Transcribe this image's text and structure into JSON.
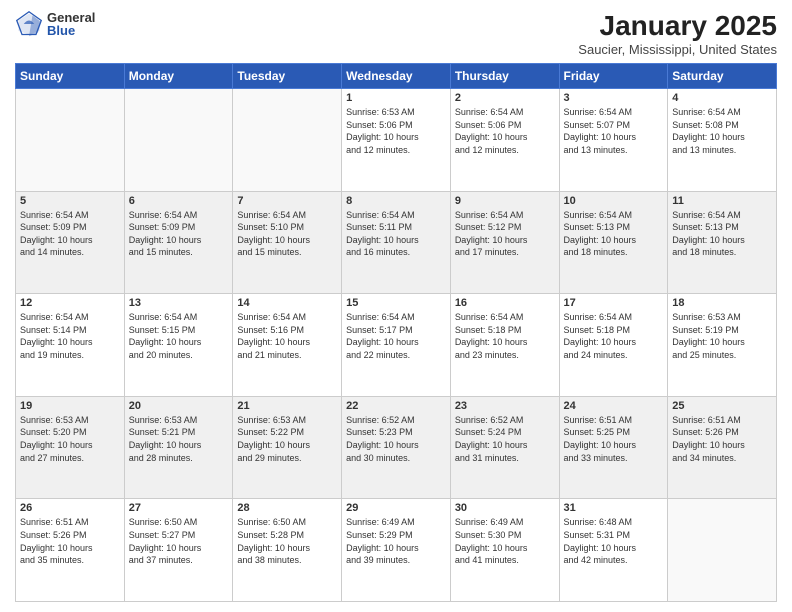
{
  "logo": {
    "general": "General",
    "blue": "Blue"
  },
  "header": {
    "month": "January 2025",
    "location": "Saucier, Mississippi, United States"
  },
  "weekdays": [
    "Sunday",
    "Monday",
    "Tuesday",
    "Wednesday",
    "Thursday",
    "Friday",
    "Saturday"
  ],
  "weeks": [
    [
      {
        "day": "",
        "info": ""
      },
      {
        "day": "",
        "info": ""
      },
      {
        "day": "",
        "info": ""
      },
      {
        "day": "1",
        "info": "Sunrise: 6:53 AM\nSunset: 5:06 PM\nDaylight: 10 hours\nand 12 minutes."
      },
      {
        "day": "2",
        "info": "Sunrise: 6:54 AM\nSunset: 5:06 PM\nDaylight: 10 hours\nand 12 minutes."
      },
      {
        "day": "3",
        "info": "Sunrise: 6:54 AM\nSunset: 5:07 PM\nDaylight: 10 hours\nand 13 minutes."
      },
      {
        "day": "4",
        "info": "Sunrise: 6:54 AM\nSunset: 5:08 PM\nDaylight: 10 hours\nand 13 minutes."
      }
    ],
    [
      {
        "day": "5",
        "info": "Sunrise: 6:54 AM\nSunset: 5:09 PM\nDaylight: 10 hours\nand 14 minutes."
      },
      {
        "day": "6",
        "info": "Sunrise: 6:54 AM\nSunset: 5:09 PM\nDaylight: 10 hours\nand 15 minutes."
      },
      {
        "day": "7",
        "info": "Sunrise: 6:54 AM\nSunset: 5:10 PM\nDaylight: 10 hours\nand 15 minutes."
      },
      {
        "day": "8",
        "info": "Sunrise: 6:54 AM\nSunset: 5:11 PM\nDaylight: 10 hours\nand 16 minutes."
      },
      {
        "day": "9",
        "info": "Sunrise: 6:54 AM\nSunset: 5:12 PM\nDaylight: 10 hours\nand 17 minutes."
      },
      {
        "day": "10",
        "info": "Sunrise: 6:54 AM\nSunset: 5:13 PM\nDaylight: 10 hours\nand 18 minutes."
      },
      {
        "day": "11",
        "info": "Sunrise: 6:54 AM\nSunset: 5:13 PM\nDaylight: 10 hours\nand 18 minutes."
      }
    ],
    [
      {
        "day": "12",
        "info": "Sunrise: 6:54 AM\nSunset: 5:14 PM\nDaylight: 10 hours\nand 19 minutes."
      },
      {
        "day": "13",
        "info": "Sunrise: 6:54 AM\nSunset: 5:15 PM\nDaylight: 10 hours\nand 20 minutes."
      },
      {
        "day": "14",
        "info": "Sunrise: 6:54 AM\nSunset: 5:16 PM\nDaylight: 10 hours\nand 21 minutes."
      },
      {
        "day": "15",
        "info": "Sunrise: 6:54 AM\nSunset: 5:17 PM\nDaylight: 10 hours\nand 22 minutes."
      },
      {
        "day": "16",
        "info": "Sunrise: 6:54 AM\nSunset: 5:18 PM\nDaylight: 10 hours\nand 23 minutes."
      },
      {
        "day": "17",
        "info": "Sunrise: 6:54 AM\nSunset: 5:18 PM\nDaylight: 10 hours\nand 24 minutes."
      },
      {
        "day": "18",
        "info": "Sunrise: 6:53 AM\nSunset: 5:19 PM\nDaylight: 10 hours\nand 25 minutes."
      }
    ],
    [
      {
        "day": "19",
        "info": "Sunrise: 6:53 AM\nSunset: 5:20 PM\nDaylight: 10 hours\nand 27 minutes."
      },
      {
        "day": "20",
        "info": "Sunrise: 6:53 AM\nSunset: 5:21 PM\nDaylight: 10 hours\nand 28 minutes."
      },
      {
        "day": "21",
        "info": "Sunrise: 6:53 AM\nSunset: 5:22 PM\nDaylight: 10 hours\nand 29 minutes."
      },
      {
        "day": "22",
        "info": "Sunrise: 6:52 AM\nSunset: 5:23 PM\nDaylight: 10 hours\nand 30 minutes."
      },
      {
        "day": "23",
        "info": "Sunrise: 6:52 AM\nSunset: 5:24 PM\nDaylight: 10 hours\nand 31 minutes."
      },
      {
        "day": "24",
        "info": "Sunrise: 6:51 AM\nSunset: 5:25 PM\nDaylight: 10 hours\nand 33 minutes."
      },
      {
        "day": "25",
        "info": "Sunrise: 6:51 AM\nSunset: 5:26 PM\nDaylight: 10 hours\nand 34 minutes."
      }
    ],
    [
      {
        "day": "26",
        "info": "Sunrise: 6:51 AM\nSunset: 5:26 PM\nDaylight: 10 hours\nand 35 minutes."
      },
      {
        "day": "27",
        "info": "Sunrise: 6:50 AM\nSunset: 5:27 PM\nDaylight: 10 hours\nand 37 minutes."
      },
      {
        "day": "28",
        "info": "Sunrise: 6:50 AM\nSunset: 5:28 PM\nDaylight: 10 hours\nand 38 minutes."
      },
      {
        "day": "29",
        "info": "Sunrise: 6:49 AM\nSunset: 5:29 PM\nDaylight: 10 hours\nand 39 minutes."
      },
      {
        "day": "30",
        "info": "Sunrise: 6:49 AM\nSunset: 5:30 PM\nDaylight: 10 hours\nand 41 minutes."
      },
      {
        "day": "31",
        "info": "Sunrise: 6:48 AM\nSunset: 5:31 PM\nDaylight: 10 hours\nand 42 minutes."
      },
      {
        "day": "",
        "info": ""
      }
    ]
  ]
}
